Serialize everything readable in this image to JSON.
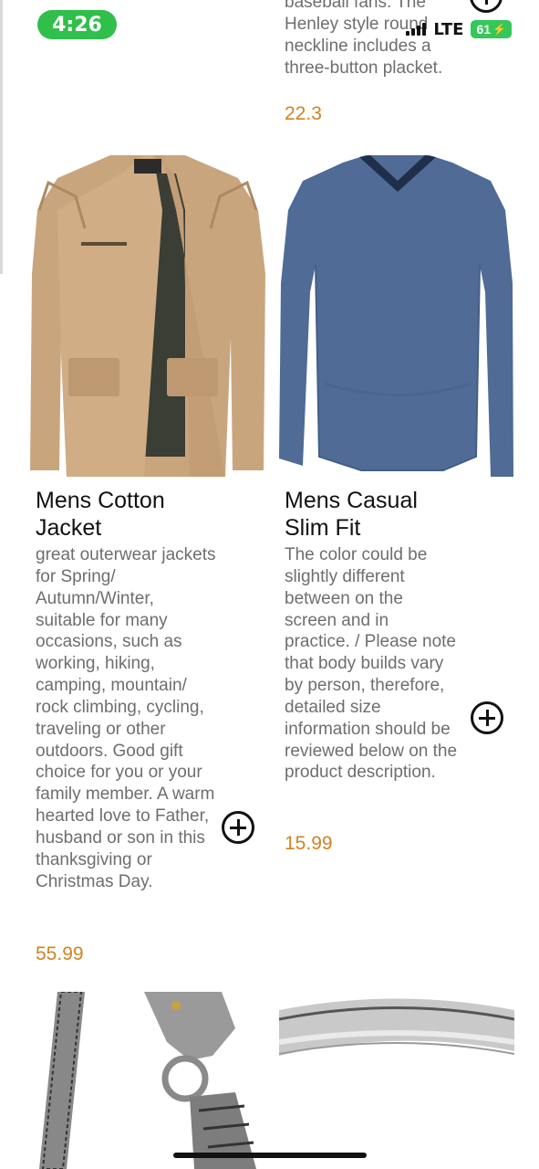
{
  "status_bar": {
    "time": "4:26",
    "network": "LTE",
    "battery": "61"
  },
  "previous_product": {
    "description_tail": "baseball fans. The Henley style round neckline includes a three-button placket.",
    "price": "22.3"
  },
  "products": [
    {
      "title": "Mens Cotton Jacket",
      "description": "great outerwear jackets for Spring/ Autumn/Winter, suitable for many occasions, such as working, hiking, camping, mountain/ rock climbing, cycling, traveling or other outdoors. Good gift choice for you or your family member. A warm hearted love to Father, husband or son in this thanksgiving or Christmas Day.",
      "price": "55.99",
      "image": "beige-cotton-jacket"
    },
    {
      "title": "Mens Casual Slim Fit",
      "description": "The color could be slightly different between on the screen and in practice. / Please note that body builds vary by person, therefore, detailed size information should be reviewed below on the product description.",
      "price": "15.99",
      "image": "blue-long-sleeve-shirt"
    }
  ],
  "next_row_images": [
    "silver-dragon-bracelet",
    "silver-bangle"
  ],
  "colors": {
    "price": "#d2821f",
    "time_pill": "#2fbf4a",
    "battery": "#34c759",
    "description": "#6e6e6e"
  }
}
